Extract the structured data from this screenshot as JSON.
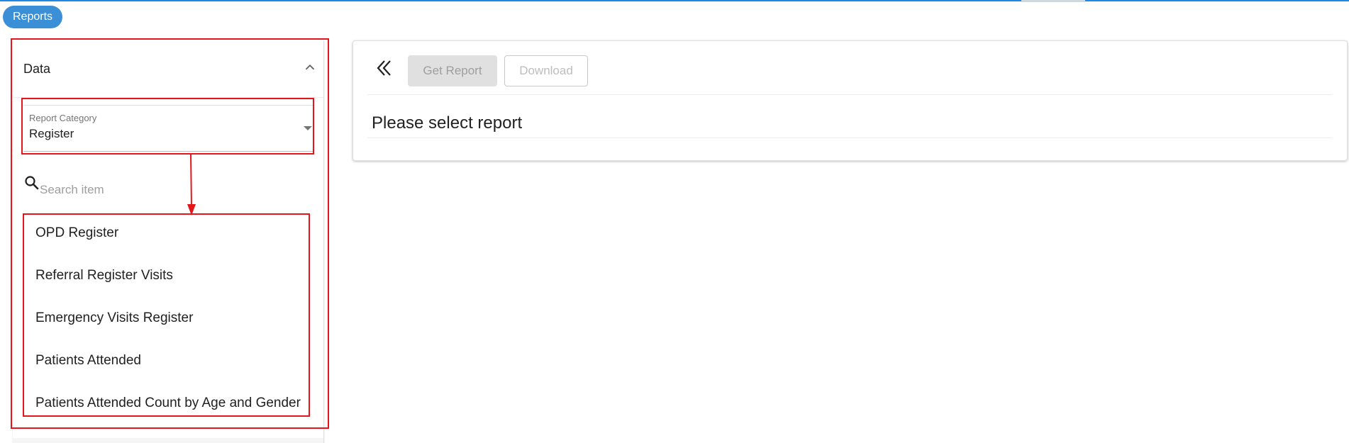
{
  "header": {
    "chip_label": "Reports"
  },
  "sidebar": {
    "accordion_title": "Data",
    "report_category": {
      "label": "Report Category",
      "value": "Register"
    },
    "search": {
      "placeholder": "Search item",
      "value": ""
    },
    "report_items": [
      {
        "label": "OPD Register"
      },
      {
        "label": "Referral Register Visits"
      },
      {
        "label": "Emergency Visits Register"
      },
      {
        "label": "Patients Attended"
      },
      {
        "label": "Patients Attended Count by Age and Gender"
      }
    ]
  },
  "main": {
    "get_report_label": "Get Report",
    "download_label": "Download",
    "title": "Please select report"
  },
  "colors": {
    "accent": "#3a8fd6",
    "annotation": "#e5161b"
  },
  "icons": {
    "accordion": "chevron-up-icon",
    "select": "dropdown-arrow-icon",
    "search": "search-icon",
    "collapse": "double-chevron-left-icon"
  }
}
